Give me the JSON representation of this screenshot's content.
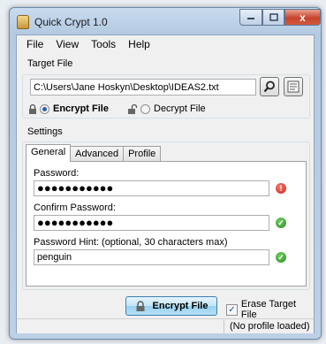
{
  "window": {
    "title": "Quick Crypt 1.0",
    "close_glyph": "x"
  },
  "menu": [
    "File",
    "View",
    "Tools",
    "Help"
  ],
  "target": {
    "group_label": "Target File",
    "path_value": "C:\\Users\\Jane Hoskyn\\Desktop\\IDEAS2.txt",
    "encrypt_label": "Encrypt File",
    "decrypt_label": "Decrypt File",
    "selected_mode": "encrypt"
  },
  "settings": {
    "group_label": "Settings",
    "tabs": [
      "General",
      "Advanced",
      "Profile"
    ],
    "active_tab": "General",
    "password_label": "Password:",
    "password_value": "●●●●●●●●●●●",
    "password_status": "error",
    "confirm_label": "Confirm Password:",
    "confirm_value": "●●●●●●●●●●●",
    "confirm_status": "ok",
    "hint_label": "Password Hint: (optional, 30 characters max)",
    "hint_value": "penguin",
    "hint_status": "ok"
  },
  "actions": {
    "encrypt_button_label": "Encrypt File",
    "erase_label": "Erase Target File",
    "erase_checked": true
  },
  "statusbar": {
    "text": "(No profile loaded)"
  }
}
